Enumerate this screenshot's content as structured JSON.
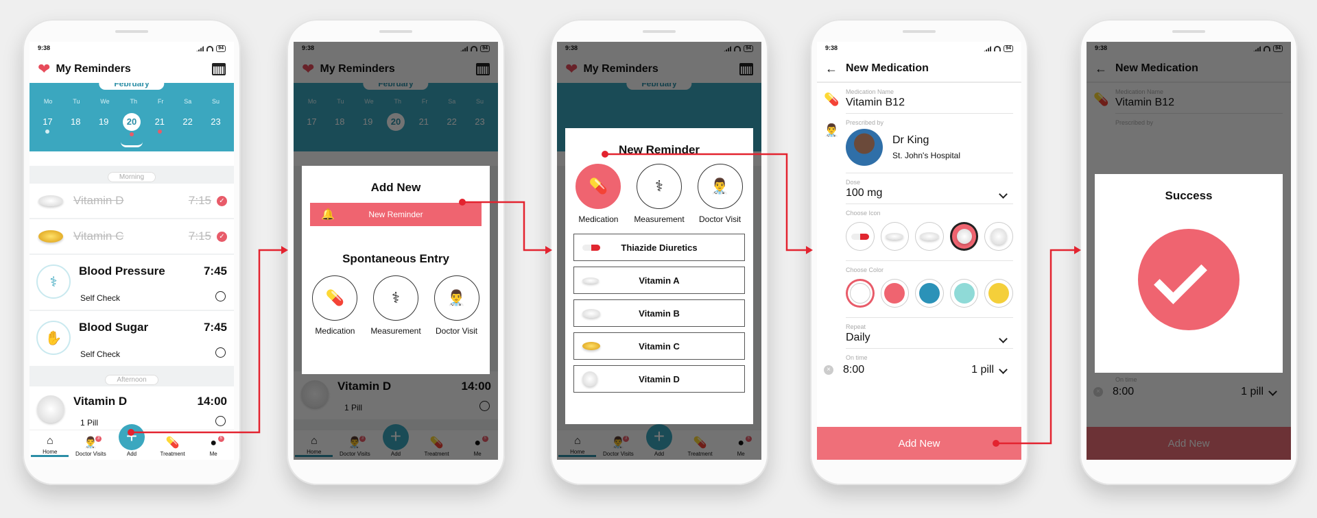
{
  "status": {
    "time": "9:38",
    "battery": "94"
  },
  "home": {
    "title": "My Reminders",
    "month": "February",
    "days": [
      "Mo",
      "Tu",
      "We",
      "Th",
      "Fr",
      "Sa",
      "Su"
    ],
    "dates": [
      "17",
      "18",
      "19",
      "20",
      "21",
      "22",
      "23"
    ],
    "morning": "Morning",
    "afternoon": "Afternoon",
    "items": [
      {
        "name": "Vitamin D",
        "time": "7:15"
      },
      {
        "name": "Vitamin C",
        "time": "7:15"
      },
      {
        "name": "Blood Pressure",
        "time": "7:45",
        "sub": "Self Check"
      },
      {
        "name": "Blood Sugar",
        "time": "7:45",
        "sub": "Self Check"
      },
      {
        "name": "Vitamin D",
        "time": "14:00",
        "sub": "1 Pill"
      }
    ],
    "nav": [
      "Home",
      "Doctor Visits",
      "Add",
      "Treatment",
      "Me"
    ],
    "nav_badges": [
      "3",
      "5"
    ]
  },
  "addnew": {
    "title": "Add New",
    "new_reminder": "New Reminder",
    "spontaneous": "Spontaneous Entry",
    "options": [
      "Medication",
      "Measurement",
      "Doctor Visit"
    ]
  },
  "newreminder": {
    "title": "New Reminder",
    "options": [
      "Medication",
      "Measurement",
      "Doctor Visit"
    ],
    "meds": [
      "Thiazide Diuretics",
      "Vitamin A",
      "Vitamin B",
      "Vitamin C",
      "Vitamin D"
    ]
  },
  "newmed": {
    "title": "New Medication",
    "name_label": "Medication Name",
    "name": "Vitamin B12",
    "presc_label": "Prescribed by",
    "doctor": "Dr King",
    "hospital": "St. John's Hospital",
    "dose_label": "Dose",
    "dose": "100 mg",
    "icon_label": "Choose Icon",
    "color_label": "Choose Color",
    "colors": [
      "#ffffff",
      "#ef6470",
      "#2b92b8",
      "#8fdad7",
      "#f4cf3a"
    ],
    "repeat_label": "Repeat",
    "repeat": "Daily",
    "ontime_label": "On time",
    "ontime": "8:00",
    "ontime_qty": "1 pill",
    "add": "Add New"
  },
  "success": {
    "title": "Success"
  }
}
